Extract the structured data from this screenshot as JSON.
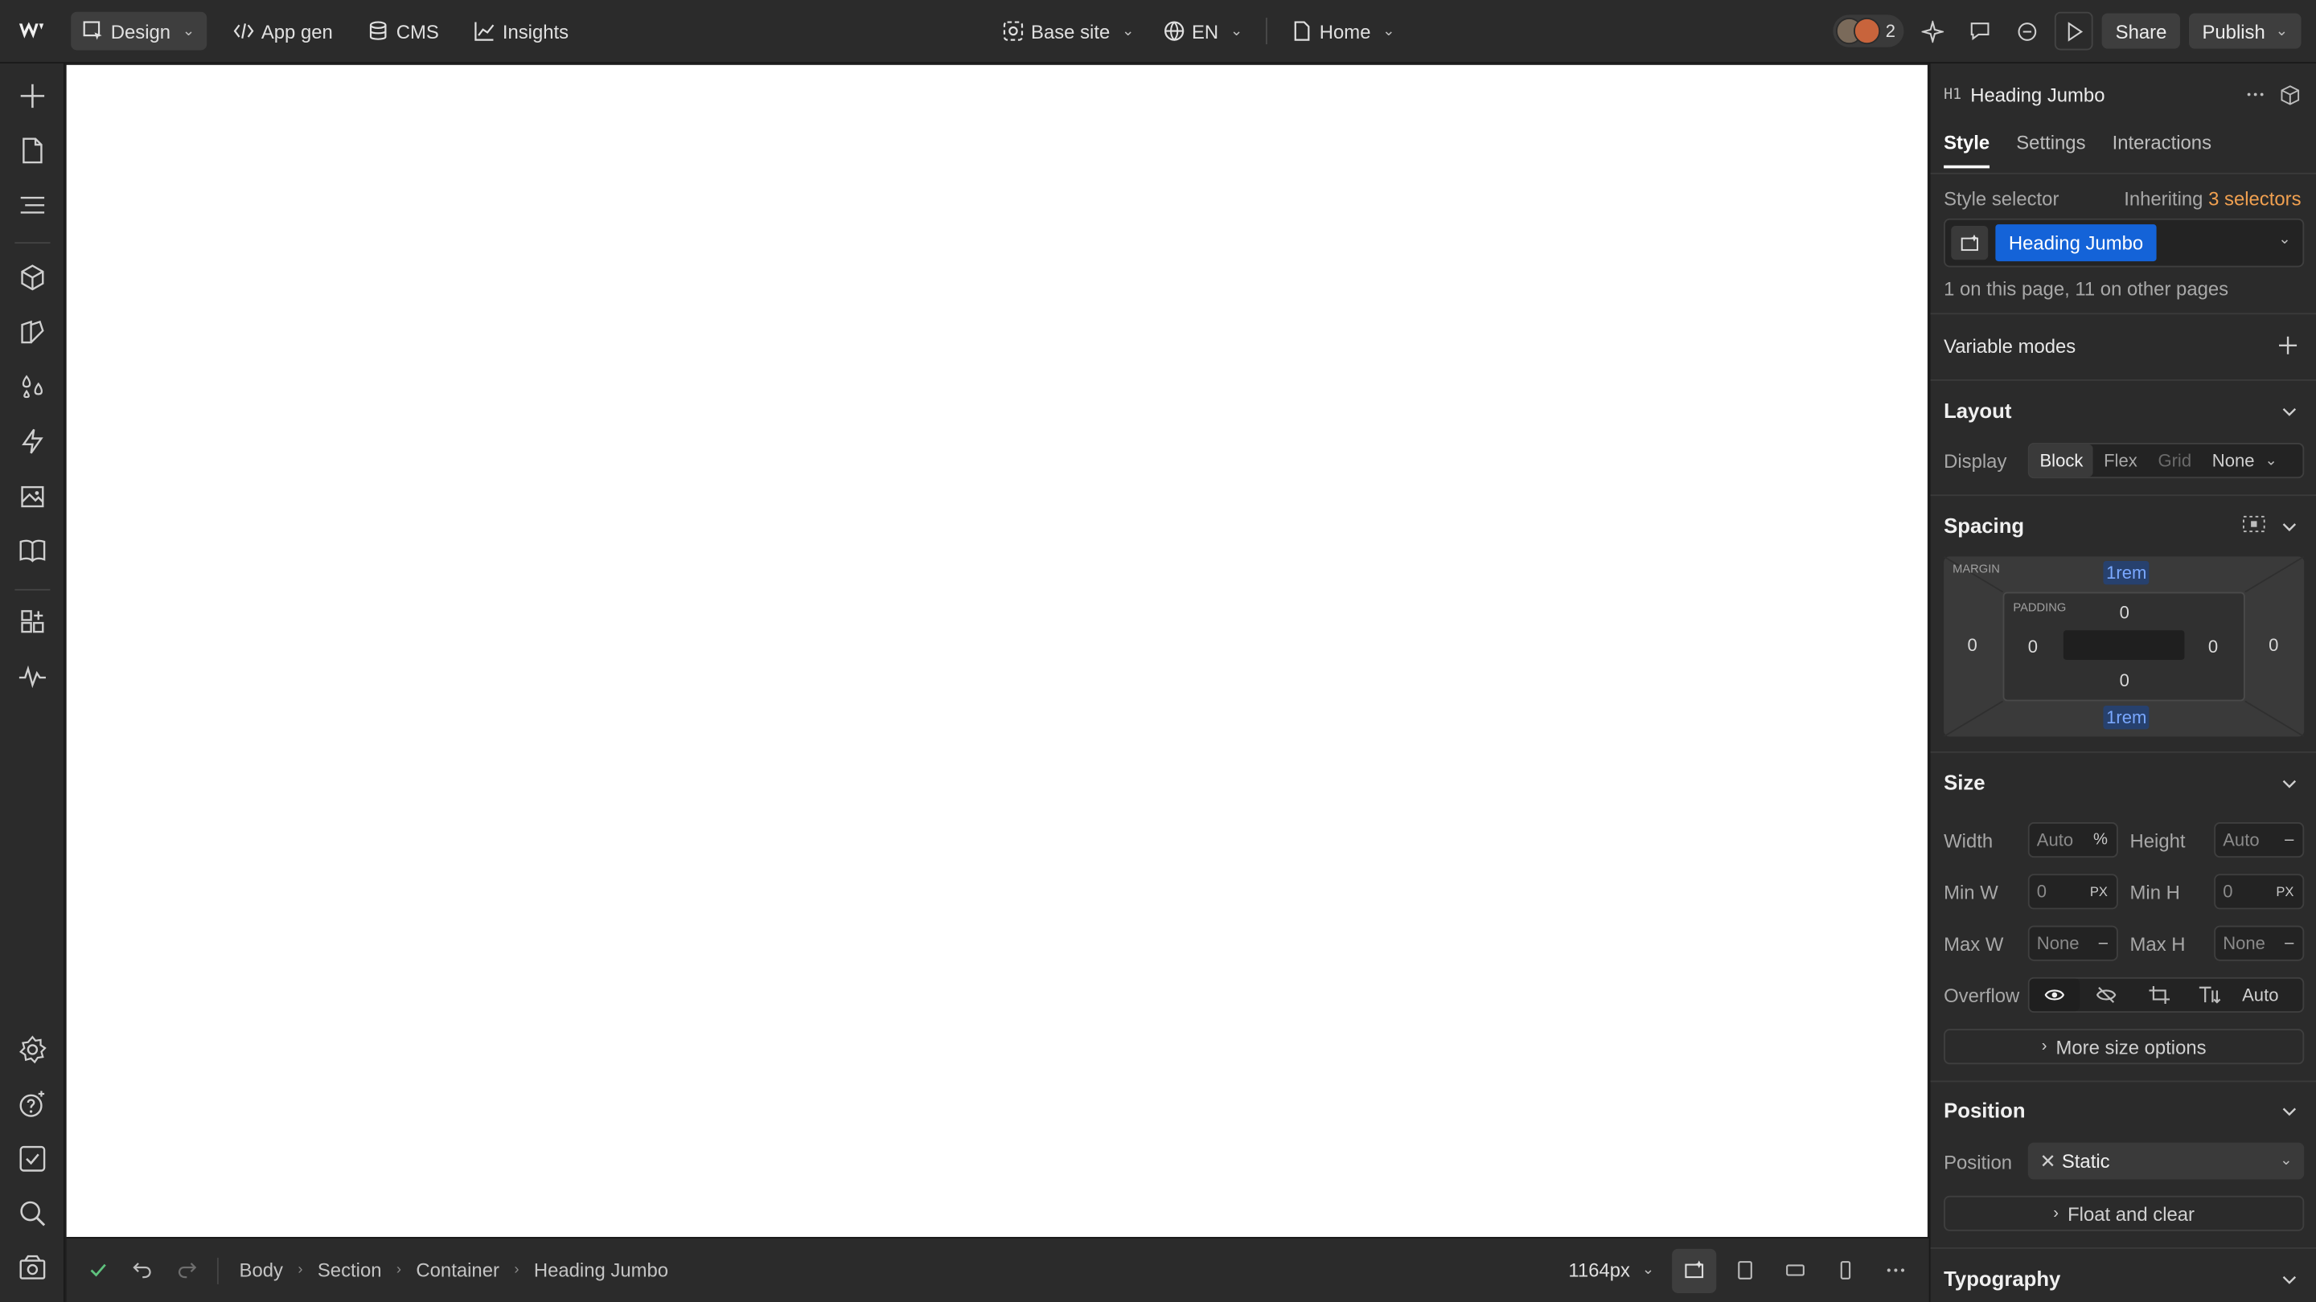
{
  "topbar": {
    "design_label": "Design",
    "appgen_label": "App gen",
    "cms_label": "CMS",
    "insights_label": "Insights",
    "site_label": "Base site",
    "locale_label": "EN",
    "page_label": "Home",
    "collaborator_count": "2",
    "share_label": "Share",
    "publish_label": "Publish"
  },
  "bottombar": {
    "breadcrumbs": [
      "Body",
      "Section",
      "Container",
      "Heading Jumbo"
    ],
    "width_label": "1164px"
  },
  "panel": {
    "element_tag": "H1",
    "element_name": "Heading Jumbo",
    "tabs": [
      "Style",
      "Settings",
      "Interactions"
    ],
    "style_selector_label": "Style selector",
    "inheriting_prefix": "Inheriting",
    "inheriting_count": "3 selectors",
    "selector_chip": "Heading Jumbo",
    "usage_text": "1 on this page, 11 on other pages",
    "variable_modes_label": "Variable modes",
    "layout": {
      "title": "Layout",
      "display_label": "Display",
      "options": [
        "Block",
        "Flex",
        "Grid",
        "None"
      ]
    },
    "spacing": {
      "title": "Spacing",
      "margin_label": "MARGIN",
      "padding_label": "PADDING",
      "margin_top": "1rem",
      "margin_bottom": "1rem",
      "margin_left": "0",
      "margin_right": "0",
      "padding_top": "0",
      "padding_bottom": "0",
      "padding_left": "0",
      "padding_right": "0"
    },
    "size": {
      "title": "Size",
      "width_label": "Width",
      "width_value": "Auto",
      "width_unit": "%",
      "height_label": "Height",
      "height_value": "Auto",
      "height_unit": "–",
      "minw_label": "Min W",
      "minw_value": "0",
      "minw_unit": "PX",
      "minh_label": "Min H",
      "minh_value": "0",
      "minh_unit": "PX",
      "maxw_label": "Max W",
      "maxw_value": "None",
      "maxw_unit": "–",
      "maxh_label": "Max H",
      "maxh_value": "None",
      "maxh_unit": "–",
      "overflow_label": "Overflow",
      "overflow_auto": "Auto",
      "more_label": "More size options"
    },
    "position": {
      "title": "Position",
      "position_label": "Position",
      "position_value": "Static",
      "float_label": "Float and clear"
    },
    "typography": {
      "title": "Typography"
    }
  },
  "colors": {
    "accent_blue": "#1463d8",
    "selector_orange": "#f0a050"
  }
}
